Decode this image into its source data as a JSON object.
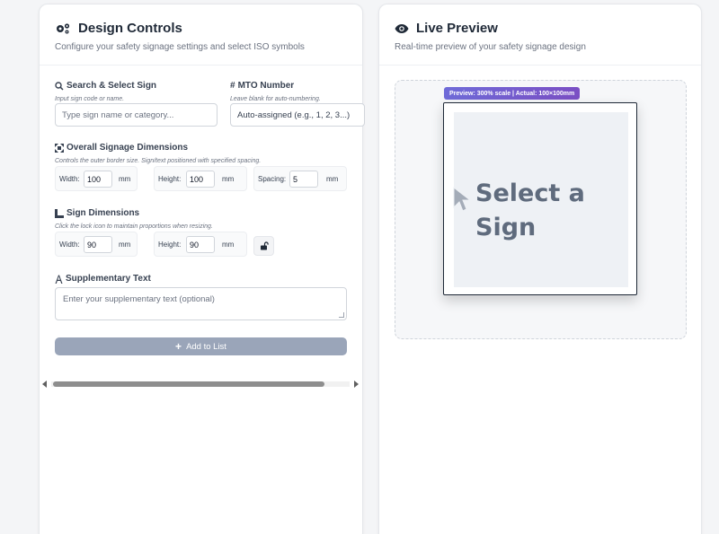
{
  "left_panel": {
    "title": "Design Controls",
    "subtitle": "Configure your safety signage settings and select ISO symbols",
    "title_icon": "gears-icon",
    "search": {
      "label": "Search & Select Sign",
      "icon": "search-icon",
      "hint": "Input sign code or name.",
      "placeholder": "Type sign name or category..."
    },
    "mto": {
      "label": "MTO Number",
      "icon": "hash-icon",
      "hint": "Leave blank for auto-numbering.",
      "placeholder": "Auto-assigned (e.g., 1, 2, 3...)"
    },
    "overall": {
      "label": "Overall Signage Dimensions",
      "icon": "expand-icon",
      "hint": "Controls the outer border size. Sign/text positioned with specified spacing.",
      "width_label": "Width:",
      "width_value": "100",
      "height_label": "Height:",
      "height_value": "100",
      "spacing_label": "Spacing:",
      "spacing_value": "5",
      "unit": "mm"
    },
    "sign": {
      "label": "Sign Dimensions",
      "icon": "ruler-icon",
      "hint": "Click the lock icon to maintain proportions when resizing.",
      "width_label": "Width:",
      "width_value": "90",
      "height_label": "Height:",
      "height_value": "90",
      "unit": "mm",
      "lock_icon": "unlock-icon"
    },
    "supplementary": {
      "label": "Supplementary Text",
      "icon": "text-icon",
      "placeholder": "Enter your supplementary text (optional)"
    },
    "add_button": "Add to List"
  },
  "right_panel": {
    "title": "Live Preview",
    "subtitle": "Real-time preview of your safety signage design",
    "title_icon": "eye-icon",
    "badge": "Preview: 300% scale | Actual: 100×100mm",
    "sign_text_line1": "Select a",
    "sign_text_line2": "Sign"
  },
  "colors": {
    "button_disabled": "#9aa5b9",
    "badge_start": "#6f6bd8",
    "badge_end": "#7b4fc4",
    "sign_text": "#5f6b7d"
  }
}
